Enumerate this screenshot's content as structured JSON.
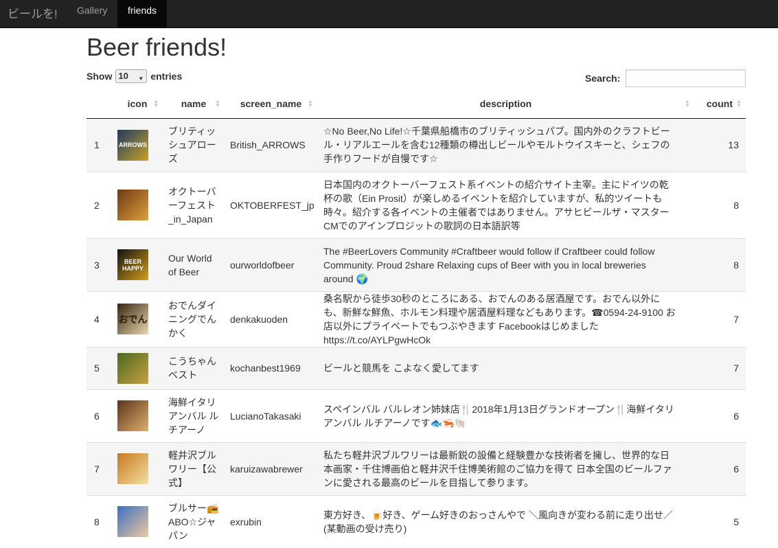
{
  "navbar": {
    "brand": "ビールを!",
    "items": [
      {
        "label": "Gallery",
        "active": false
      },
      {
        "label": "friends",
        "active": true
      }
    ]
  },
  "page": {
    "title": "Beer friends!"
  },
  "controls": {
    "show_label": "Show",
    "entries_value": "10",
    "entries_label": "entries",
    "search_label": "Search:",
    "search_value": ""
  },
  "table": {
    "columns": [
      {
        "label": ""
      },
      {
        "label": "icon"
      },
      {
        "label": "name"
      },
      {
        "label": "screen_name"
      },
      {
        "label": "description"
      },
      {
        "label": "count"
      }
    ],
    "rows": [
      {
        "num": "1",
        "icon_name": "british-arrows-logo-icon",
        "icon_colors": [
          "#1e3a5f",
          "#c9a227"
        ],
        "icon_text": "ARROWS",
        "name": "ブリティッシュアローズ",
        "screen_name": "British_ARROWS",
        "description": "☆No Beer,No Life!☆千葉県船橋市のブリティッシュパブ。国内外のクラフトビール・リアルエールを含む12種類の樽出しビールやモルトウイスキーと、シェフの手作りフードが自慢です☆",
        "count": "13"
      },
      {
        "num": "2",
        "icon_name": "beer-mug-icon",
        "icon_colors": [
          "#6b3a10",
          "#e0a040"
        ],
        "icon_text": "",
        "name": "オクトーバーフェスト_in_Japan",
        "screen_name": "OKTOBERFEST_jp",
        "description": "日本国内のオクトーバーフェスト系イベントの紹介サイト主宰。主にドイツの乾杯の歌（Ein Prosit）が楽しめるイベントを紹介していますが、私的ツイートも時々。紹介する各イベントの主催者ではありません。アサヒビールザ・マスターCMでのアインプロジットの歌詞の日本語訳等",
        "count": "8"
      },
      {
        "num": "3",
        "icon_name": "dont-worry-beer-happy-icon",
        "icon_colors": [
          "#111111",
          "#d4a017"
        ],
        "icon_text": "BEER HAPPY",
        "name": "Our World of Beer",
        "screen_name": "ourworldofbeer",
        "description": "The #BeerLovers Community #Craftbeer would follow if Craftbeer could follow Community. Proud 2share Relaxing cups of Beer with you in local breweries around 🌍",
        "count": "8"
      },
      {
        "num": "4",
        "icon_name": "oden-lantern-icon",
        "icon_colors": [
          "#3a2410",
          "#e8d8b0"
        ],
        "icon_text": "おでん",
        "name": "おでんダイニングでんかく",
        "screen_name": "denkakuoden",
        "description": "桑名駅から徒歩30秒のところにある、おでんのある居酒屋です。おでん以外にも、新鮮な鮮魚、ホルモン料理や居酒屋料理などもあります。☎0594-24-9100 お店以外にプライベートでもつぶやきます Facebookはじめましたhttps://t.co/AYLPgwHcOk",
        "count": "7"
      },
      {
        "num": "5",
        "icon_name": "tree-avenue-photo-icon",
        "icon_colors": [
          "#4a6a20",
          "#c8a040"
        ],
        "icon_text": "",
        "name": "こうちゃんベスト",
        "screen_name": "kochanbest1969",
        "description": "ビールと競馬を こよなく愛してます",
        "count": "7"
      },
      {
        "num": "6",
        "icon_name": "bar-counter-photo-icon",
        "icon_colors": [
          "#5a3418",
          "#e0b070"
        ],
        "icon_text": "",
        "name": "海鮮イタリアンバル ルチアーノ",
        "screen_name": "LucianoTakasaki",
        "description": "スペインバル バルレオン姉妹店🍴2018年1月13日グランドオープン🍴海鮮イタリアンバル ルチアーノです🐟🦐🐚",
        "count": "6"
      },
      {
        "num": "7",
        "icon_name": "beer-glasses-toast-icon",
        "icon_colors": [
          "#c87820",
          "#f4e0a0"
        ],
        "icon_text": "",
        "name": "軽井沢ブルワリー【公式】",
        "screen_name": "karuizawabrewer",
        "description": "私たち軽井沢ブルワリーは最新鋭の設備と経験豊かな技術者を擁し、世界的な日本画家・千住博画伯と軽井沢千住博美術館のご協力を得て 日本全国のビールファンに愛される最高のビールを目指して参ります。",
        "count": "6"
      },
      {
        "num": "8",
        "icon_name": "anime-character-avatar-icon",
        "icon_colors": [
          "#3a70c0",
          "#f0c8a0"
        ],
        "icon_text": "",
        "name": "ブルサー📻ABO☆ジャパン",
        "screen_name": "exrubin",
        "description": "東方好き、🍺好き、ゲーム好きのおっさんやで ＼風向きが変わる前に走り出せ／(某動画の受け売り)",
        "count": "5"
      }
    ]
  }
}
